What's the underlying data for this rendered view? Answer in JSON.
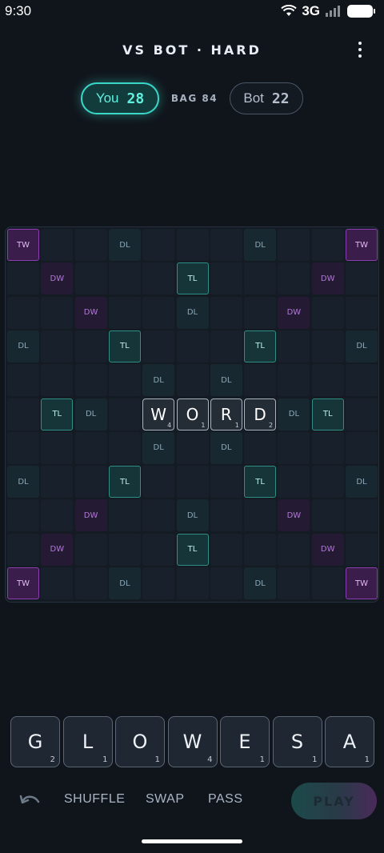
{
  "status_bar": {
    "time": "9:30",
    "network": "3G"
  },
  "header": {
    "title": "VS BOT · HARD"
  },
  "scores": {
    "you_label": "You",
    "you_score": "28",
    "bag_label": "BAG 84",
    "bot_label": "Bot",
    "bot_score": "22"
  },
  "board": {
    "size": 11,
    "premiums": [
      {
        "r": 0,
        "c": 0,
        "type": "TW"
      },
      {
        "r": 0,
        "c": 3,
        "type": "DL"
      },
      {
        "r": 0,
        "c": 7,
        "type": "DL"
      },
      {
        "r": 0,
        "c": 10,
        "type": "TW"
      },
      {
        "r": 1,
        "c": 1,
        "type": "DW"
      },
      {
        "r": 1,
        "c": 5,
        "type": "TL"
      },
      {
        "r": 1,
        "c": 9,
        "type": "DW"
      },
      {
        "r": 2,
        "c": 2,
        "type": "DW"
      },
      {
        "r": 2,
        "c": 5,
        "type": "DL"
      },
      {
        "r": 2,
        "c": 8,
        "type": "DW"
      },
      {
        "r": 3,
        "c": 0,
        "type": "DL"
      },
      {
        "r": 3,
        "c": 3,
        "type": "TL"
      },
      {
        "r": 3,
        "c": 7,
        "type": "TL"
      },
      {
        "r": 3,
        "c": 10,
        "type": "DL"
      },
      {
        "r": 4,
        "c": 4,
        "type": "DL"
      },
      {
        "r": 4,
        "c": 6,
        "type": "DL"
      },
      {
        "r": 5,
        "c": 1,
        "type": "TL"
      },
      {
        "r": 5,
        "c": 2,
        "type": "DL"
      },
      {
        "r": 5,
        "c": 8,
        "type": "DL"
      },
      {
        "r": 5,
        "c": 9,
        "type": "TL"
      },
      {
        "r": 6,
        "c": 4,
        "type": "DL"
      },
      {
        "r": 6,
        "c": 6,
        "type": "DL"
      },
      {
        "r": 7,
        "c": 0,
        "type": "DL"
      },
      {
        "r": 7,
        "c": 3,
        "type": "TL"
      },
      {
        "r": 7,
        "c": 7,
        "type": "TL"
      },
      {
        "r": 7,
        "c": 10,
        "type": "DL"
      },
      {
        "r": 8,
        "c": 2,
        "type": "DW"
      },
      {
        "r": 8,
        "c": 5,
        "type": "DL"
      },
      {
        "r": 8,
        "c": 8,
        "type": "DW"
      },
      {
        "r": 9,
        "c": 1,
        "type": "DW"
      },
      {
        "r": 9,
        "c": 5,
        "type": "TL"
      },
      {
        "r": 9,
        "c": 9,
        "type": "DW"
      },
      {
        "r": 10,
        "c": 0,
        "type": "TW"
      },
      {
        "r": 10,
        "c": 3,
        "type": "DL"
      },
      {
        "r": 10,
        "c": 7,
        "type": "DL"
      },
      {
        "r": 10,
        "c": 10,
        "type": "TW"
      }
    ],
    "tiles": [
      {
        "r": 5,
        "c": 4,
        "letter": "W",
        "points": "4"
      },
      {
        "r": 5,
        "c": 5,
        "letter": "O",
        "points": "1"
      },
      {
        "r": 5,
        "c": 6,
        "letter": "R",
        "points": "1"
      },
      {
        "r": 5,
        "c": 7,
        "letter": "D",
        "points": "2"
      }
    ]
  },
  "rack": [
    {
      "letter": "G",
      "points": "2"
    },
    {
      "letter": "L",
      "points": "1"
    },
    {
      "letter": "O",
      "points": "1"
    },
    {
      "letter": "W",
      "points": "4"
    },
    {
      "letter": "E",
      "points": "1"
    },
    {
      "letter": "S",
      "points": "1"
    },
    {
      "letter": "A",
      "points": "1"
    }
  ],
  "controls": {
    "shuffle_label": "SHUFFLE",
    "swap_label": "SWAP",
    "pass_label": "PASS",
    "play_label": "PLAY"
  }
}
